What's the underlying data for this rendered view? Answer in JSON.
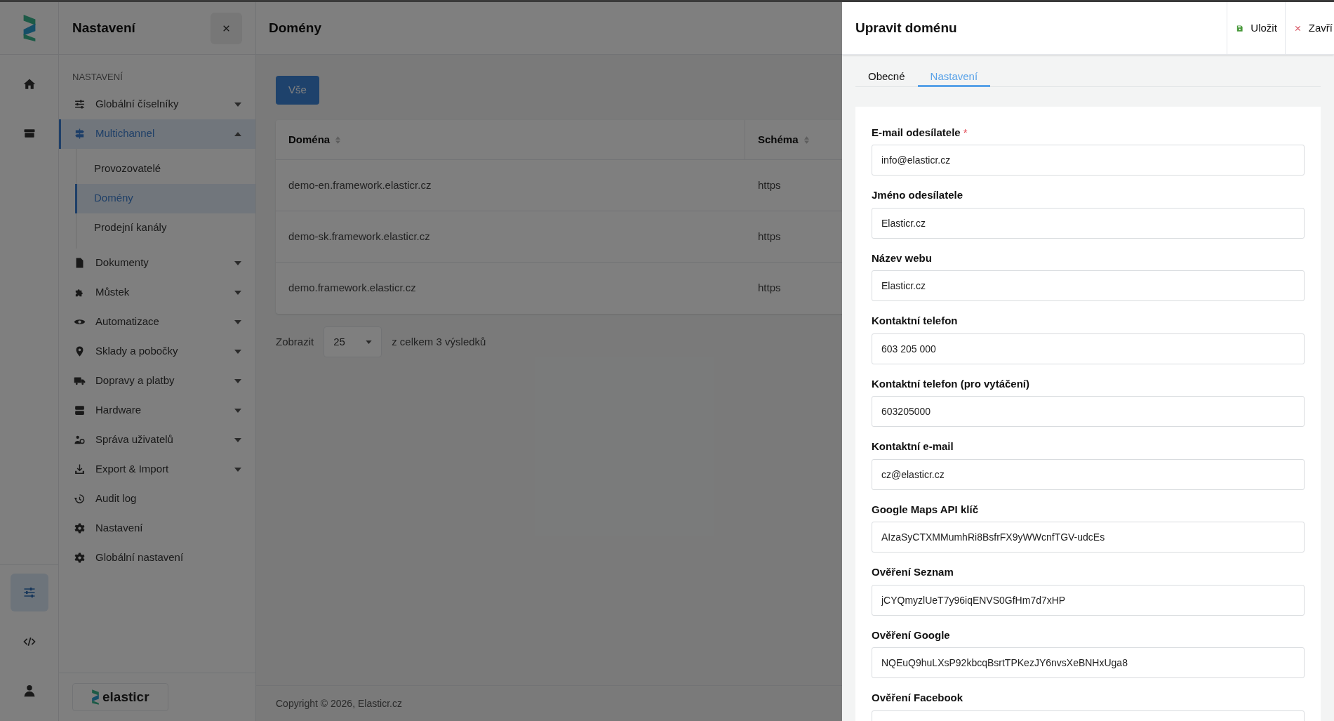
{
  "rail": {
    "top": [
      {
        "kind": "home",
        "selected": false
      },
      {
        "kind": "archive",
        "selected": false
      }
    ],
    "bottom": [
      {
        "kind": "sliders",
        "selected": true
      },
      {
        "kind": "code",
        "selected": false
      },
      {
        "kind": "user",
        "selected": false
      }
    ]
  },
  "sidebar": {
    "title": "Nastavení",
    "section": "NASTAVENÍ",
    "brand": "elasticr",
    "items": [
      {
        "kind": "sliders",
        "label": "Globální číselníky",
        "expanded": false,
        "selected": false
      },
      {
        "kind": "signpost",
        "label": "Multichannel",
        "expanded": true,
        "selected": true,
        "children": [
          {
            "label": "Provozovatelé",
            "selected": false
          },
          {
            "label": "Domény",
            "selected": true
          },
          {
            "label": "Prodejní kanály",
            "selected": false
          }
        ]
      },
      {
        "kind": "file",
        "label": "Dokumenty",
        "expanded": false,
        "selected": false
      },
      {
        "kind": "puzzle",
        "label": "Můstek",
        "expanded": false,
        "selected": false
      },
      {
        "kind": "eye",
        "label": "Automatizace",
        "expanded": false,
        "selected": false
      },
      {
        "kind": "pin",
        "label": "Sklady a pobočky",
        "expanded": false,
        "selected": false
      },
      {
        "kind": "truck",
        "label": "Dopravy a platby",
        "expanded": false,
        "selected": false
      },
      {
        "kind": "server",
        "label": "Hardware",
        "expanded": false,
        "selected": false
      },
      {
        "kind": "users",
        "label": "Správa uživatelů",
        "expanded": false,
        "selected": false
      },
      {
        "kind": "download",
        "label": "Export & Import",
        "expanded": false,
        "selected": false
      },
      {
        "kind": "history",
        "label": "Audit log",
        "selected": false
      },
      {
        "kind": "gear",
        "label": "Nastavení",
        "selected": false
      },
      {
        "kind": "gear",
        "label": "Globální nastavení",
        "selected": false
      }
    ]
  },
  "main": {
    "title": "Domény",
    "filters": [
      {
        "label": "Vše",
        "selected": true
      }
    ],
    "table": {
      "columns": [
        "Doména",
        "Schéma"
      ],
      "rows": [
        [
          "demo-en.framework.elasticr.cz",
          "https"
        ],
        [
          "demo-sk.framework.elasticr.cz",
          "https"
        ],
        [
          "demo.framework.elasticr.cz",
          "https"
        ]
      ]
    },
    "pagination": {
      "label": "Zobrazit",
      "page_size": "25",
      "summary": "z celkem 3 výsledků"
    },
    "footer": "Copyright © 2026, Elasticr.cz"
  },
  "drawer": {
    "title": "Upravit doménu",
    "actions": [
      {
        "kind": "save",
        "label": "Uložit"
      },
      {
        "kind": "close",
        "label": "Zavří"
      }
    ],
    "tabs": [
      {
        "label": "Obecné",
        "selected": false
      },
      {
        "label": "Nastavení",
        "selected": true
      }
    ],
    "fields": [
      {
        "label": "E-mail odesílatele",
        "required_mark": "*",
        "value": "info@elasticr.cz"
      },
      {
        "label": "Jméno odesílatele",
        "value": "Elasticr.cz"
      },
      {
        "label": "Název webu",
        "value": "Elasticr.cz"
      },
      {
        "label": "Kontaktní telefon",
        "value": "603 205 000"
      },
      {
        "label": "Kontaktní telefon (pro vytáčení)",
        "value": "603205000"
      },
      {
        "label": "Kontaktní e-mail",
        "value": "cz@elasticr.cz"
      },
      {
        "label": "Google Maps API klíč",
        "value": "AIzaSyCTXMMumhRi8BsfrFX9yWWcnfTGV-udcEs"
      },
      {
        "label": "Ověření Seznam",
        "value": "jCYQmyzlUeT7y96iqENVS0GfHm7d7xHP"
      },
      {
        "label": "Ověření Google",
        "value": "NQEuQ9huLXsP92kbcqBsrtTPKezJY6nvsXeBNHxUga8"
      },
      {
        "label": "Ověření Facebook"
      }
    ]
  }
}
